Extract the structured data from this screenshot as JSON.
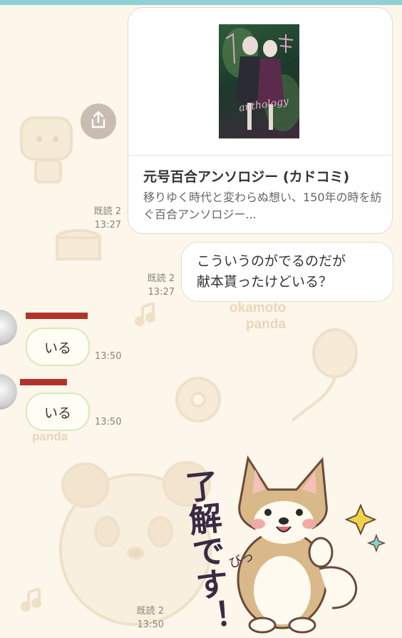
{
  "messages": {
    "link_card": {
      "title": "元号百合アンソロジー (カドコミ)",
      "description": "移りゆく時代と変わらぬ想い、150年の時を紡ぐ百合アンソロジー...",
      "cover_text": "anthology",
      "read_label": "既読 2",
      "time": "13:27"
    },
    "outgoing": {
      "text_line1": "こういうのがでるのだが",
      "text_line2": "献本貰ったけどいる？",
      "read_label": "既読 2",
      "time": "13:27"
    },
    "incoming": [
      {
        "text": "いる",
        "time": "13:50"
      },
      {
        "text": "いる",
        "time": "13:50"
      }
    ],
    "sticker": {
      "text": "了解です！",
      "sfx": "びっ",
      "read_label": "既読 2",
      "time": "13:50"
    }
  },
  "background": {
    "text1": "okamoto",
    "text2": "panda",
    "text3": "panda"
  },
  "icons": {
    "share": "share-icon"
  },
  "colors": {
    "top_bar": "#8ed0d6",
    "background": "#fdf6ea",
    "incoming_border": "#d4ecb8",
    "redaction": "#b0342b"
  }
}
